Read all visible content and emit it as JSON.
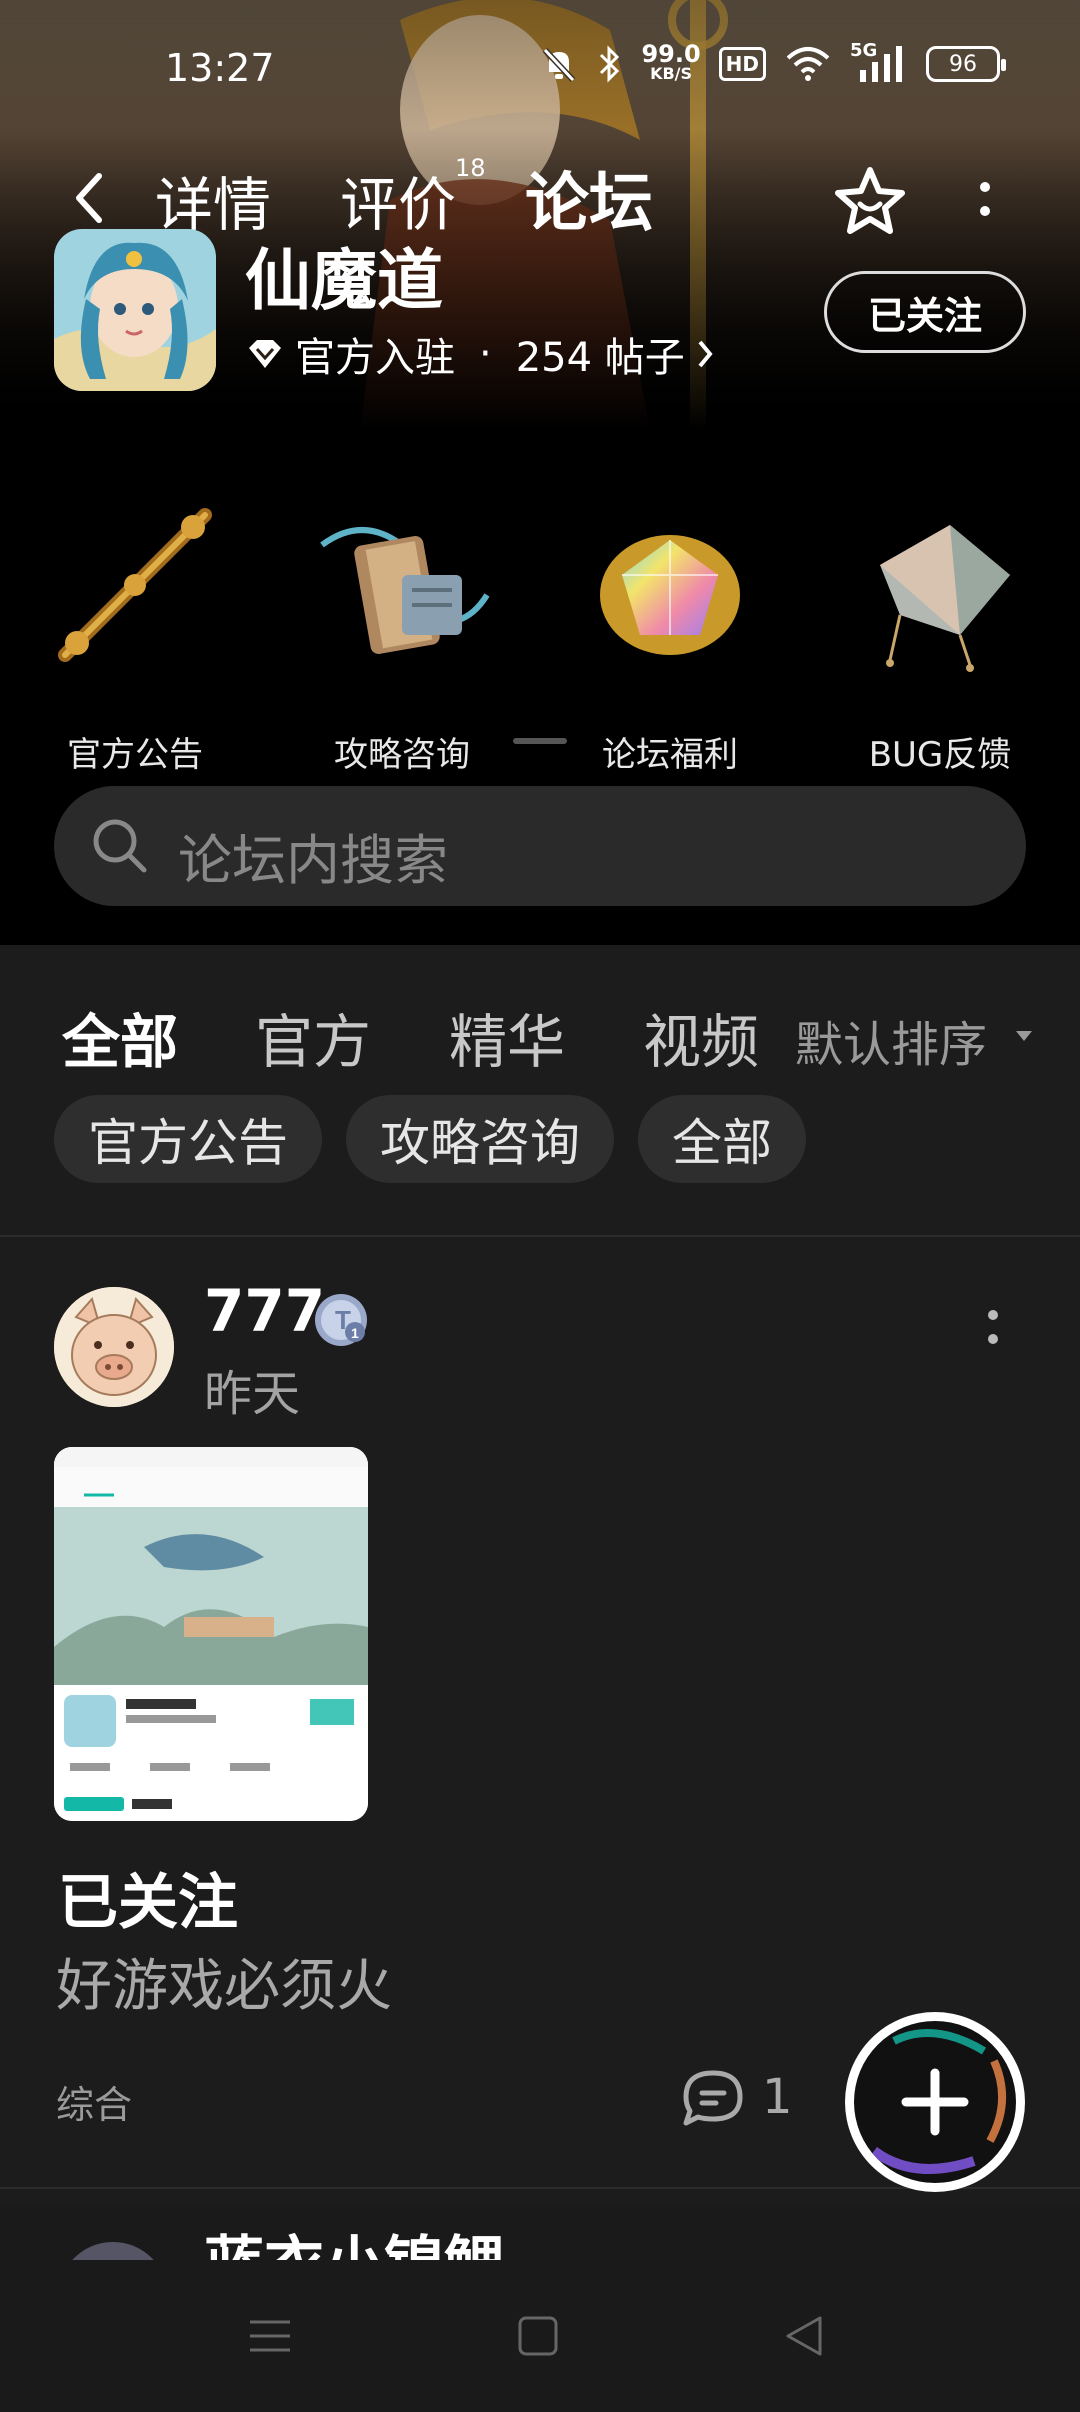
{
  "status_bar": {
    "time": "13:27",
    "net_speed_value": "99.0",
    "net_speed_unit": "KB/S",
    "hd": "HD",
    "network": "5G",
    "battery": "96"
  },
  "nav": {
    "tabs": [
      {
        "label": "详情"
      },
      {
        "label": "评价",
        "badge": "18"
      },
      {
        "label": "论坛",
        "active": true
      }
    ]
  },
  "game": {
    "name": "仙魔道",
    "official": "官方入驻",
    "separator": "·",
    "posts": "254 帖子",
    "follow_label": "已关注"
  },
  "quick_links": [
    {
      "label": "官方公告",
      "icon": "golden-staff-icon"
    },
    {
      "label": "攻略咨询",
      "icon": "scroll-book-icon"
    },
    {
      "label": "论坛福利",
      "icon": "rainbow-gem-icon"
    },
    {
      "label": "BUG反馈",
      "icon": "broken-kite-icon"
    }
  ],
  "search": {
    "placeholder": "论坛内搜索"
  },
  "feed_tabs": [
    {
      "label": "全部",
      "active": true
    },
    {
      "label": "官方"
    },
    {
      "label": "精华"
    },
    {
      "label": "视频"
    }
  ],
  "sort": {
    "label": "默认排序"
  },
  "chips": [
    {
      "label": "官方公告"
    },
    {
      "label": "攻略咨询"
    },
    {
      "label": "全部"
    }
  ],
  "post": {
    "username": "777",
    "time": "昨天",
    "title": "已关注",
    "body": "好游戏必须火",
    "tag": "综合",
    "comments": "1"
  },
  "next_post": {
    "username": "蓝衣小锦鲤"
  },
  "colors": {
    "accent": "#14b8a6",
    "background": "#1c1c1c"
  }
}
